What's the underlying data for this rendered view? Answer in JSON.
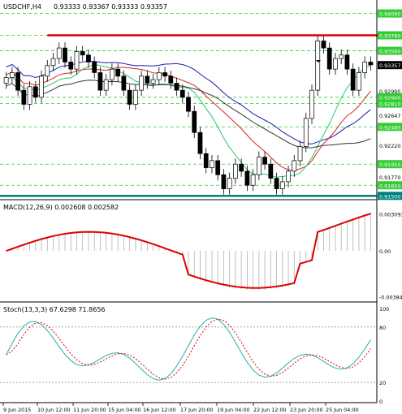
{
  "header": {
    "symbol": "USDCHF,H4",
    "ohlc": "0.93333 0.93367 0.93333 0.93357"
  },
  "main_panel": {
    "price_levels": [
      {
        "label": "0.94090",
        "value": 0.9409,
        "highlight": "#33cc33"
      },
      {
        "label": "0.93780",
        "value": 0.9378,
        "highlight": "#33cc33"
      },
      {
        "label": "0.93560",
        "value": 0.9356,
        "highlight": "#33cc33"
      },
      {
        "label": "0.93357",
        "value": 0.93357,
        "highlight": "#000000"
      },
      {
        "label": "0.92990",
        "value": 0.9299,
        "highlight": null
      },
      {
        "label": "0.92900",
        "value": 0.929,
        "highlight": "#33cc33"
      },
      {
        "label": "0.92810",
        "value": 0.9281,
        "highlight": "#33cc33"
      },
      {
        "label": "0.92647",
        "value": 0.92647,
        "highlight": null
      },
      {
        "label": "0.92480",
        "value": 0.9248,
        "highlight": "#33cc33"
      },
      {
        "label": "0.92220",
        "value": 0.9222,
        "highlight": null
      },
      {
        "label": "0.91950",
        "value": 0.9195,
        "highlight": "#33cc33"
      },
      {
        "label": "0.91770",
        "value": 0.9177,
        "highlight": null
      },
      {
        "label": "0.91650",
        "value": 0.9165,
        "highlight": "#33cc33"
      },
      {
        "label": "0.91500",
        "value": 0.915,
        "highlight": "#008080"
      }
    ],
    "resistance_lines": [
      {
        "price": 0.9378,
        "from_day": 10.5,
        "to_day": 23.0
      },
      {
        "price": 0.9352,
        "from_day": 23.0,
        "to_day": 25.5
      }
    ],
    "support_line_price": 0.915,
    "colors": {
      "bull": "#ffffff",
      "bear": "#000000",
      "ma_fast": "#1b1bb4",
      "ma_mid": "#dd2222",
      "ma_slow": "#22cc66",
      "ma_black": "#333333",
      "guide": "#33cc33",
      "resistance": "#dd0000",
      "support": "#008080"
    }
  },
  "macd_panel": {
    "title": "MACD(12,26,9) 0.002608 0.002582",
    "axis_labels": [
      {
        "label": "0.003093",
        "value": 0.003093
      },
      {
        "label": "0.00",
        "value": 0.0
      },
      {
        "label": "-0.003842",
        "value": -0.003842
      }
    ]
  },
  "stoch_panel": {
    "title": "Stoch(13,3,3) 67.6298 71.8656",
    "axis_labels": [
      {
        "label": "100",
        "value": 100
      },
      {
        "label": "80",
        "value": 80
      },
      {
        "label": "20",
        "value": 20
      },
      {
        "label": "0",
        "value": 0
      }
    ]
  },
  "time_axis": [
    {
      "label": "9 Jun 2015",
      "day": 9.0
    },
    {
      "label": "10 Jun 12:00",
      "day": 10.5
    },
    {
      "label": "11 Jun 20:00",
      "day": 11.83
    },
    {
      "label": "15 Jun 04:00",
      "day": 13.17
    },
    {
      "label": "16 Jun 12:00",
      "day": 14.5
    },
    {
      "label": "17 Jun 20:00",
      "day": 15.83
    },
    {
      "label": "19 Jun 04:00",
      "day": 17.17
    },
    {
      "label": "22 Jun 12:00",
      "day": 18.5
    },
    {
      "label": "23 Jun 20:00",
      "day": 19.83
    },
    {
      "label": "25 Jun 04:00",
      "day": 21.17
    }
  ]
}
